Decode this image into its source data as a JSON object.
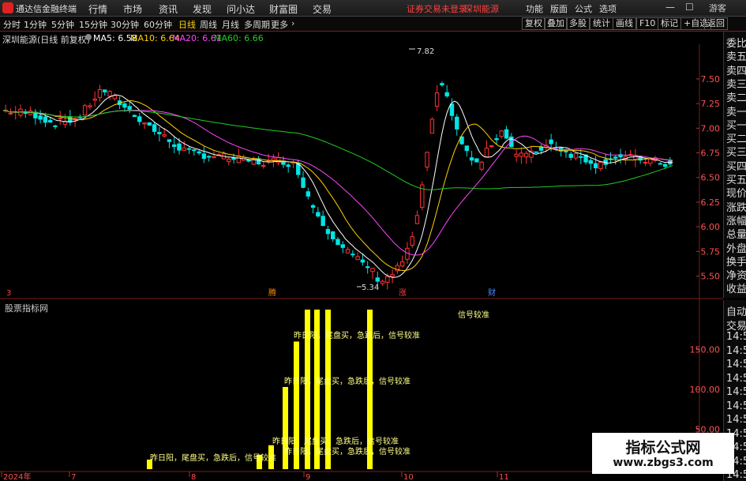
{
  "app": {
    "title": "通达信金融终端",
    "notice": "证券交易未登录",
    "notice2": "深圳能源"
  },
  "menu": [
    "行情",
    "市场",
    "资讯",
    "发现",
    "问小达",
    "财富圈",
    "交易"
  ],
  "right_menu": [
    "功能",
    "版面",
    "公式",
    "选项"
  ],
  "window": {
    "minimize": "—",
    "maximize": "☐",
    "close": "✕"
  },
  "timeframes": [
    {
      "label": "分时",
      "active": false
    },
    {
      "label": "1分钟",
      "active": false
    },
    {
      "label": "5分钟",
      "active": false
    },
    {
      "label": "15分钟",
      "active": false
    },
    {
      "label": "30分钟",
      "active": false
    },
    {
      "label": "60分钟",
      "active": false
    },
    {
      "label": "日线",
      "active": true
    },
    {
      "label": "周线",
      "active": false
    },
    {
      "label": "月线",
      "active": false
    },
    {
      "label": "多周期",
      "active": false
    },
    {
      "label": "更多",
      "active": false
    }
  ],
  "tool_buttons": [
    "复权",
    "叠加",
    "多股",
    "统计",
    "画线",
    "F10",
    "标记",
    "+自选",
    "返回"
  ],
  "info": {
    "title": "深圳能源(日线 前复权)",
    "ma": [
      {
        "label": "MA5: 6.58",
        "color": "#ffffff"
      },
      {
        "label": "MA10: 6.64",
        "color": "#ffd200"
      },
      {
        "label": "MA20: 6.61",
        "color": "#ff44ff"
      },
      {
        "label": "MA60: 6.66",
        "color": "#22cc22"
      }
    ]
  },
  "right_panel": [
    "委比",
    "卖五",
    "卖四",
    "卖三",
    "卖二",
    "卖一",
    "买一",
    "买二",
    "买三",
    "买四",
    "买五",
    "现价",
    "涨跌",
    "涨幅",
    "总量",
    "外盘",
    "换手",
    "净资",
    "收益"
  ],
  "right_panel_lower": [
    "自动",
    "交易",
    "14:5",
    "14:5",
    "14:5",
    "14:5",
    "14:5",
    "14:5",
    "14:5",
    "14:5",
    "14:5",
    "14:5",
    "14:5"
  ],
  "price_axis": [
    "7.50",
    "7.25",
    "7.00",
    "6.75",
    "6.50",
    "6.25",
    "6.00",
    "5.75",
    "5.50"
  ],
  "annotations": {
    "high": "7.82",
    "low": "5.34"
  },
  "markers": [
    {
      "text": "3",
      "color": "#ff4040"
    },
    {
      "text": "腾",
      "color": "#ff8800"
    },
    {
      "text": "涨",
      "color": "#ff4040"
    },
    {
      "text": "财",
      "color": "#4a8cff"
    }
  ],
  "indicator": {
    "title": "股票指标网",
    "axis": [
      "150.00",
      "100.00",
      "50.00"
    ],
    "signal_text": "昨日阳，尾盘买，急跌后，信号较准",
    "signal_text_short": "昨日阳，尾盘买，急跌后，信号较准",
    "top_text": "信号较准"
  },
  "date_axis": [
    "2024年",
    "7",
    "8",
    "9",
    "10",
    "11"
  ],
  "watermark": {
    "line1": "指标公式网",
    "line2": "www.zbgs3.com"
  },
  "colors": {
    "up": "#ff3232",
    "down": "#00e5e5",
    "ma5": "#ffffff",
    "ma10": "#ffd200",
    "ma20": "#ff44ff",
    "ma60": "#22cc22",
    "signal": "#ffff00"
  }
}
